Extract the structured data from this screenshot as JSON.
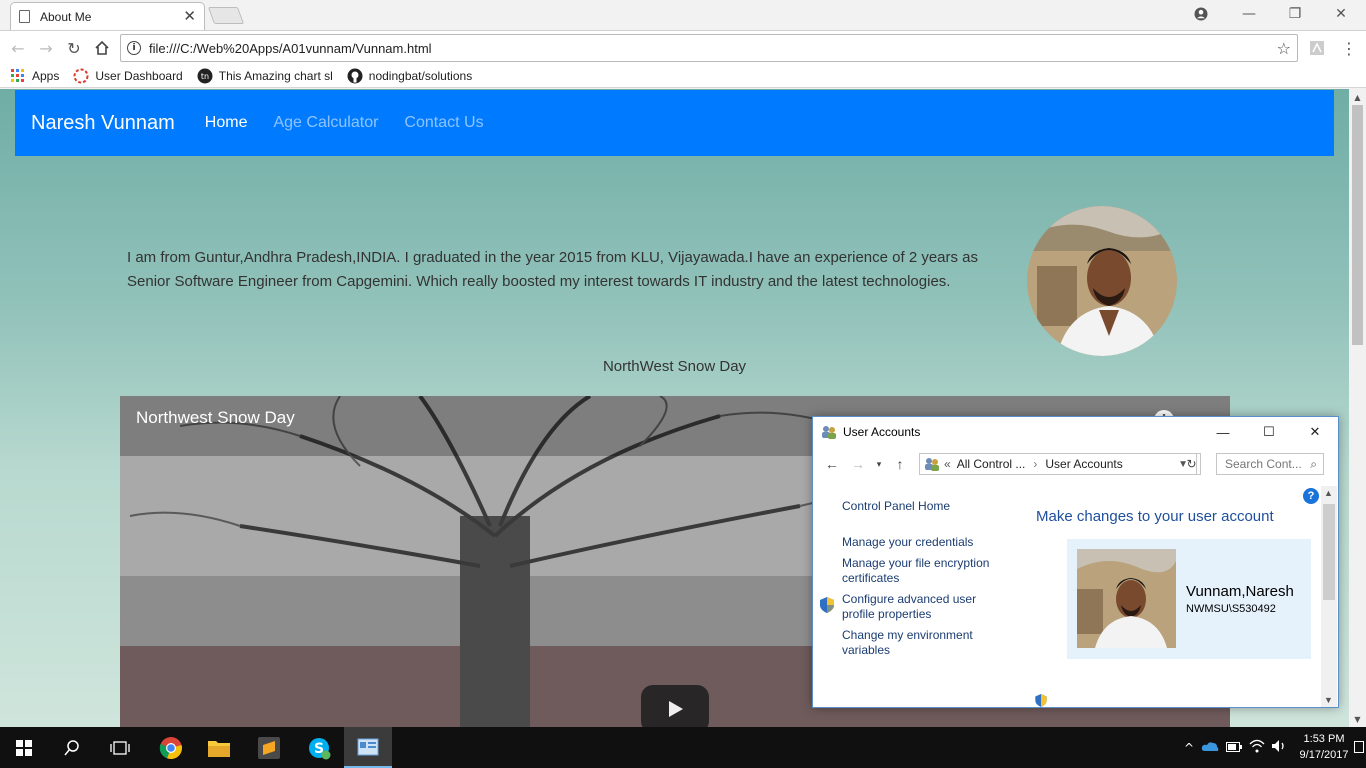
{
  "browser": {
    "tab_title": "About Me",
    "url": "file:///C:/Web%20Apps/A01vunnam/Vunnam.html",
    "bookmarks": [
      {
        "label": "Apps",
        "icon": "apps-grid-icon"
      },
      {
        "label": "User Dashboard",
        "icon": "dashboard-icon"
      },
      {
        "label": "This Amazing chart sl",
        "icon": "tn-icon"
      },
      {
        "label": "nodingbat/solutions",
        "icon": "github-icon"
      }
    ]
  },
  "page": {
    "brand": "Naresh Vunnam",
    "nav": [
      {
        "label": "Home",
        "active": true
      },
      {
        "label": "Age Calculator",
        "active": false
      },
      {
        "label": "Contact Us",
        "active": false
      }
    ],
    "about_text": "I am from Guntur,Andhra Pradesh,INDIA. I graduated in the year 2015 from KLU, Vijayawada.I have an experience of 2 years as Senior Software Engineer from Capgemini. Which really boosted my interest towards IT industry and the latest technologies.",
    "video_caption": "NorthWest Snow Day",
    "video_title": "Northwest Snow Day"
  },
  "dialog": {
    "title": "User Accounts",
    "breadcrumb_prefix": "«",
    "breadcrumb_1": "All Control ...",
    "breadcrumb_2": "User Accounts",
    "search_placeholder": "Search Cont...",
    "side_home": "Control Panel Home",
    "side_links": [
      "Manage your credentials",
      "Manage your file encryption certificates",
      "Configure advanced user profile properties",
      "Change my environment variables"
    ],
    "main_title": "Make changes to your user account",
    "user_name": "Vunnam,Naresh",
    "user_id": "NWMSU\\S530492"
  },
  "taskbar": {
    "time": "1:53 PM",
    "date": "9/17/2017"
  },
  "colors": {
    "navbar": "#007bff",
    "link": "#1b3d72",
    "taskbar": "#101010"
  }
}
